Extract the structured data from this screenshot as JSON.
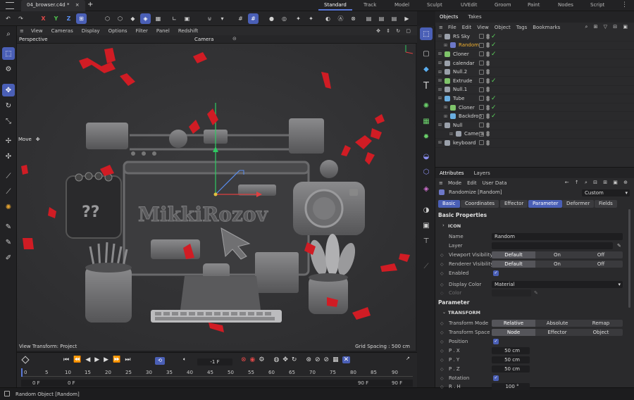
{
  "window": {
    "file_tab": "04_browser.c4d *",
    "new_tab": "+"
  },
  "layouts": [
    "Standard",
    "Track",
    "Model",
    "Sculpt",
    "UVEdit",
    "Groom",
    "Paint",
    "Nodes",
    "Script"
  ],
  "axis_labels": {
    "x": "X",
    "y": "Y",
    "z": "Z"
  },
  "viewport": {
    "menu": [
      "View",
      "Cameras",
      "Display",
      "Options",
      "Filter",
      "Panel",
      "Redshift"
    ],
    "name": "Perspective",
    "camera": "Camera",
    "tool_label": "Move",
    "view_transform": "View Transform: Project",
    "grid_spacing": "Grid Spacing : 500 cm",
    "scene_text": "MikkiRozov"
  },
  "timeline": {
    "current_frame": "-1 F",
    "ruler_ticks": [
      "0",
      "5",
      "10",
      "15",
      "20",
      "25",
      "30",
      "35",
      "40",
      "45",
      "50",
      "55",
      "60",
      "65",
      "70",
      "75",
      "80",
      "85",
      "90"
    ],
    "start": "0 F",
    "start2": "0 F",
    "end": "90 F",
    "end2": "90 F"
  },
  "status": "Random Object [Random]",
  "objects_panel": {
    "tabs": [
      "Objects",
      "Takes"
    ],
    "menu": [
      "File",
      "Edit",
      "View",
      "Object",
      "Tags",
      "Bookmarks"
    ],
    "items": [
      {
        "name": "RS Sky",
        "indent": 0,
        "color": "#9aa0aa",
        "tick": true
      },
      {
        "name": "Random",
        "indent": 1,
        "color": "#6d78c8",
        "tick": true,
        "selected": true
      },
      {
        "name": "Cloner",
        "indent": 0,
        "color": "#7fc46a",
        "tick": true
      },
      {
        "name": "calendar",
        "indent": 0,
        "color": "#9aa0aa",
        "tick": false
      },
      {
        "name": "Null.2",
        "indent": 0,
        "color": "#9aa0aa",
        "tick": false
      },
      {
        "name": "Extrude",
        "indent": 0,
        "color": "#7fc46a",
        "tick": true
      },
      {
        "name": "Null.1",
        "indent": 0,
        "color": "#9aa0aa",
        "tick": false
      },
      {
        "name": "Tube",
        "indent": 0,
        "color": "#6aaee0",
        "tick": true
      },
      {
        "name": "Cloner",
        "indent": 1,
        "color": "#7fc46a",
        "tick": true
      },
      {
        "name": "Backdrop",
        "indent": 1,
        "color": "#6aaee0",
        "tick": true
      },
      {
        "name": "Null",
        "indent": 0,
        "color": "#9aa0aa",
        "tick": false
      },
      {
        "name": "Camera",
        "indent": 2,
        "color": "#9aa0aa",
        "tick": false
      },
      {
        "name": "keyboard",
        "indent": 0,
        "color": "#9aa0aa",
        "tick": false
      }
    ]
  },
  "attributes_panel": {
    "tabs": [
      "Attributes",
      "Layers"
    ],
    "menu": [
      "Mode",
      "Edit",
      "User Data"
    ],
    "object": "Randomize [Random]",
    "mode_select": "Custom",
    "subtabs": [
      "Basic",
      "Coordinates",
      "Effector",
      "Parameter",
      "Deformer",
      "Fields"
    ],
    "basic_title": "Basic Properties",
    "icon_section": "ICON",
    "name_label": "Name",
    "name_value": "Random",
    "layer_label": "Layer",
    "viewport_vis": {
      "label": "Viewport Visibility",
      "options": [
        "Default",
        "On",
        "Off"
      ]
    },
    "renderer_vis": {
      "label": "Renderer Visibility",
      "options": [
        "Default",
        "On",
        "Off"
      ]
    },
    "enabled_label": "Enabled",
    "display_color": {
      "label": "Display Color",
      "value": "Material"
    },
    "color_label": "Color",
    "parameter_title": "Parameter",
    "transform_section": "TRANSFORM",
    "transform_mode": {
      "label": "Transform Mode",
      "options": [
        "Relative",
        "Absolute",
        "Remap"
      ]
    },
    "transform_space": {
      "label": "Transform Space",
      "options": [
        "Node",
        "Effector",
        "Object"
      ]
    },
    "position_label": "Position",
    "px": {
      "label": "P . X",
      "value": "50 cm"
    },
    "py": {
      "label": "P . Y",
      "value": "50 cm"
    },
    "pz": {
      "label": "P . Z",
      "value": "50 cm"
    },
    "rotation_label": "Rotation",
    "rh": {
      "label": "R . H",
      "value": "100 °"
    }
  }
}
